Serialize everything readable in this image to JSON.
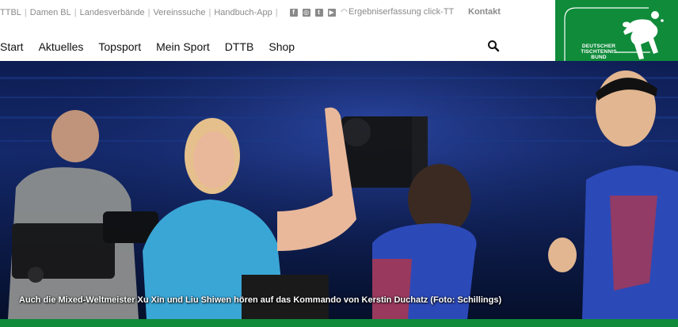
{
  "topbar": {
    "links": [
      {
        "label": "TTBL"
      },
      {
        "label": "Damen BL"
      },
      {
        "label": "Landesverbände"
      },
      {
        "label": "Vereinssuche"
      },
      {
        "label": "Handbuch-App"
      }
    ],
    "social_icons": [
      "facebook-icon",
      "instagram-icon",
      "twitter-icon",
      "youtube-icon",
      "rss-icon"
    ],
    "ergebnis_label": "Ergebniserfassung click-TT",
    "kontakt_label": "Kontakt"
  },
  "mainnav": {
    "items": [
      {
        "label": "Start"
      },
      {
        "label": "Aktuelles"
      },
      {
        "label": "Topsport"
      },
      {
        "label": "Mein Sport"
      },
      {
        "label": "DTTB"
      },
      {
        "label": "Shop"
      }
    ],
    "search_icon": "search-icon"
  },
  "logo": {
    "line1": "DEUTSCHER",
    "line2": "TISCHTENNIS",
    "line3": "BUND"
  },
  "hero": {
    "caption": "Auch die Mixed-Weltmeister Xu Xin und Liu Shiwen hören auf das Kommando von Kerstin Duchatz (Foto: Schillings)"
  },
  "colors": {
    "brand_green": "#0f8b3a",
    "topbar_text": "#8a8a8a",
    "nav_text": "#111111"
  }
}
